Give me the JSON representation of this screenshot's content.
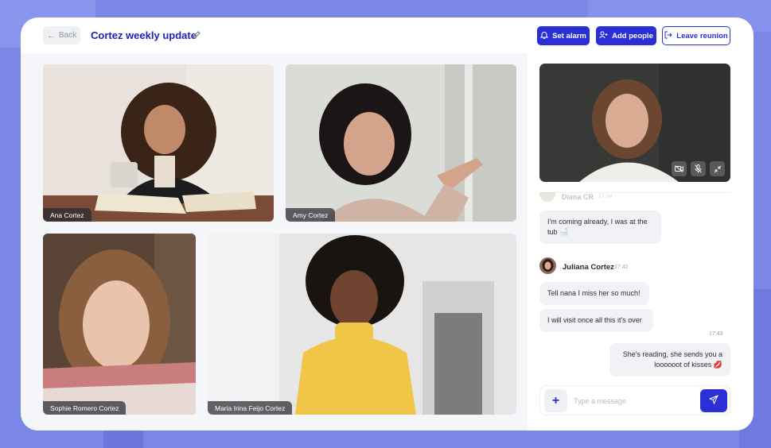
{
  "header": {
    "back_label": "Back",
    "meeting_title": "Cortez weekly update",
    "set_alarm_label": "Set alarm",
    "add_people_label": "Add people",
    "leave_label": "Leave reunion"
  },
  "participants": [
    {
      "name": "Ana Cortez"
    },
    {
      "name": "Amy Cortez"
    },
    {
      "name": "Sophie Romero Cortez"
    },
    {
      "name": "Maria Irina Feijo Cortez"
    }
  ],
  "chat": {
    "faded_sender": "Diana CR",
    "faded_time": "17:34",
    "messages": [
      {
        "text": "I'm coming already, I was at the tub 🛁"
      },
      {
        "sender": "Juliana Cortez",
        "time": "17:42"
      },
      {
        "text": "Tell nana I miss her so much!"
      },
      {
        "text": "I will visit once all this it's over"
      },
      {
        "time": "17:43"
      },
      {
        "text": "She's reading, she sends you a loooooot of kisses 💋"
      }
    ],
    "input_placeholder": "Type a message"
  },
  "colors": {
    "accent": "#2b2fd6",
    "background": "#7b87e6"
  }
}
